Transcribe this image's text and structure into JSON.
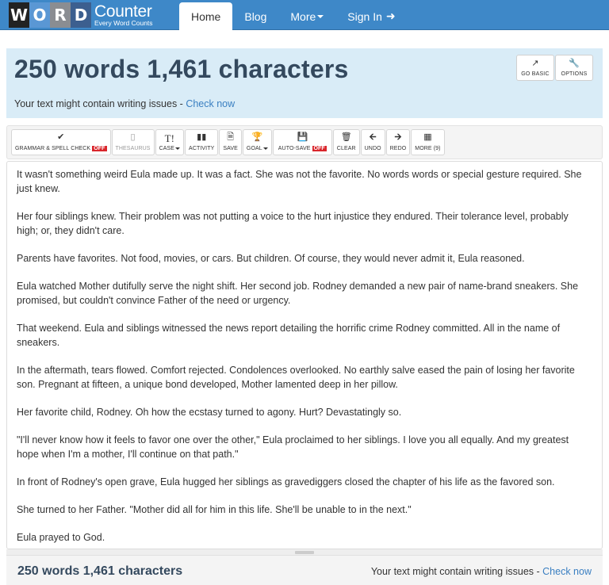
{
  "navbar": {
    "logo_letters": [
      "W",
      "O",
      "R",
      "D"
    ],
    "brand_title": "Counter",
    "brand_tagline": "Every Word Counts",
    "items": [
      {
        "label": "Home",
        "active": true
      },
      {
        "label": "Blog",
        "active": false
      },
      {
        "label": "More",
        "active": false,
        "has_dropdown": true
      },
      {
        "label": "Sign In",
        "active": false,
        "icon": "sign-in-icon"
      }
    ]
  },
  "summary": {
    "title": "250 words 1,461 characters",
    "word_count": 250,
    "character_count": "1,461",
    "issues_text": "Your text might contain writing issues - ",
    "check_link": "Check now",
    "buttons": [
      {
        "label": "GO BASIC",
        "icon": "external-link-icon"
      },
      {
        "label": "OPTIONS",
        "icon": "wrench-icon"
      }
    ]
  },
  "toolbar": {
    "off_badge": "OFF",
    "buttons": [
      {
        "label": "GRAMMAR & SPELL CHECK",
        "icon": "check-icon",
        "badge": "OFF"
      },
      {
        "label": "THESAURUS",
        "icon": "book-icon",
        "disabled": true
      },
      {
        "label": "CASE",
        "icon": "text-case-icon",
        "dropdown": true
      },
      {
        "label": "ACTIVITY",
        "icon": "bar-chart-icon"
      },
      {
        "label": "SAVE",
        "icon": "save-file-icon"
      },
      {
        "label": "GOAL",
        "icon": "trophy-icon",
        "dropdown": true
      },
      {
        "label": "AUTO-SAVE",
        "icon": "floppy-disk-icon",
        "badge": "OFF"
      },
      {
        "label": "CLEAR",
        "icon": "trash-icon"
      },
      {
        "label": "UNDO",
        "icon": "arrow-left-icon"
      },
      {
        "label": "REDO",
        "icon": "arrow-right-icon"
      },
      {
        "label": "MORE (9)",
        "icon": "grid-icon"
      }
    ]
  },
  "editor": {
    "paragraphs": [
      "It wasn't something weird Eula made up. It was a fact. She was not the favorite. No words words or special gesture required. She just knew.",
      "Her four siblings knew. Their problem was not putting a voice to the hurt injustice they endured. Their tolerance level, probably high; or,  they didn't care.",
      "Parents have favorites. Not food, movies, or cars. But children. Of course, they would never admit it, Eula reasoned.",
      "Eula watched Mother dutifully serve the night shift. Her second job. Rodney demanded a new pair of name-brand sneakers. She promised, but couldn't convince Father of the need or urgency.",
      "That weekend. Eula and siblings witnessed the news report detailing the horrific crime Rodney committed. All in the name of sneakers.",
      "In the aftermath, tears flowed. Comfort rejected. Condolences overlooked. No earthly salve eased the pain of losing her favorite son. Pregnant at fifteen, a unique bond developed, Mother lamented deep in her pillow.",
      "Her favorite child, Rodney. Oh how the ecstasy turned to agony. Hurt? Devastatingly so.",
      "\"I'll never know how it feels to favor one over the other,\" Eula proclaimed to her siblings. I love you all equally. And my greatest hope when I'm a mother, I'll continue on that path.\"",
      "In front of Rodney's open grave, Eula hugged her siblings as gravediggers closed the chapter of his life as the favored son.",
      "She turned to her Father. \"Mother did all for him in this life. She'll be unable to in the next.\"",
      "Eula prayed to God."
    ]
  },
  "bottom_bar": {
    "stats": "250 words 1,461 characters",
    "issues_text": "Your text might contain writing issues - ",
    "check_link": "Check now"
  }
}
